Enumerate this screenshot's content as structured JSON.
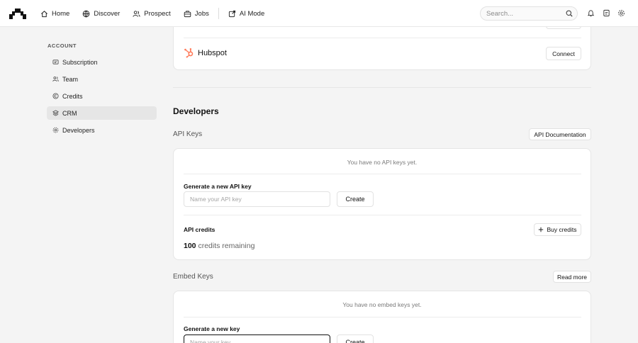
{
  "nav": {
    "items": [
      {
        "label": "Home",
        "icon": "home-icon"
      },
      {
        "label": "Discover",
        "icon": "globe-icon"
      },
      {
        "label": "Prospect",
        "icon": "users-icon"
      },
      {
        "label": "Jobs",
        "icon": "briefcase-icon"
      },
      {
        "label": "AI Mode",
        "icon": "external-icon"
      }
    ],
    "search_placeholder": "Search..."
  },
  "sidebar": {
    "heading": "ACCOUNT",
    "items": [
      {
        "label": "Subscription",
        "icon": "receipt-icon"
      },
      {
        "label": "Team",
        "icon": "team-icon"
      },
      {
        "label": "Credits",
        "icon": "credits-icon"
      },
      {
        "label": "CRM",
        "icon": "crm-icon",
        "active": true
      },
      {
        "label": "Developers",
        "icon": "developers-icon"
      }
    ]
  },
  "crm": {
    "hubspot_name": "Hubspot",
    "connect_label": "Connect"
  },
  "developers": {
    "title": "Developers",
    "api_keys": {
      "title": "API Keys",
      "doc_button": "API Documentation",
      "empty_text": "You have no API keys yet.",
      "generate_label": "Generate a new API key",
      "input_placeholder": "Name your API key",
      "create_label": "Create",
      "credits_label": "API credits",
      "buy_label": "Buy credits",
      "credits_count": "100",
      "credits_suffix": "credits remaining"
    },
    "embed_keys": {
      "title": "Embed Keys",
      "read_more": "Read more",
      "empty_text": "You have no embed keys yet.",
      "generate_label": "Generate a new key",
      "input_placeholder": "Name your key",
      "create_label": "Create"
    }
  },
  "colors": {
    "hubspot_orange": "#ff7a59",
    "active_bg": "#e6e6e6"
  }
}
